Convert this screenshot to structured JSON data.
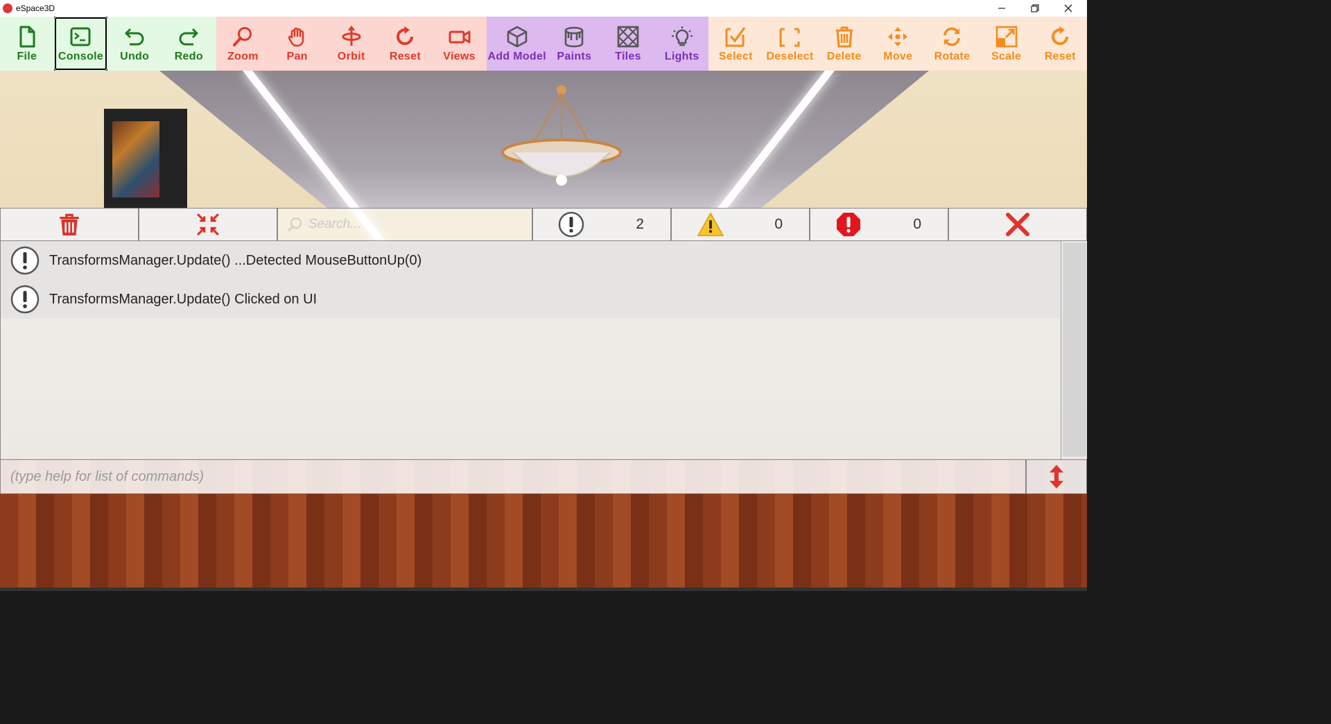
{
  "window": {
    "title": "eSpace3D"
  },
  "toolbar": {
    "file": "File",
    "console": "Console",
    "undo": "Undo",
    "redo": "Redo",
    "zoom": "Zoom",
    "pan": "Pan",
    "orbit": "Orbit",
    "reset_camera": "Reset",
    "views": "Views",
    "add_model": "Add Model",
    "paints": "Paints",
    "tiles": "Tiles",
    "lights": "Lights",
    "select": "Select",
    "deselect": "Deselect",
    "delete": "Delete",
    "move": "Move",
    "rotate": "Rotate",
    "scale": "Scale",
    "reset_transform": "Reset"
  },
  "colors": {
    "file_group_bg": "#e3f9e3",
    "file_group_fg": "#1e7a1e",
    "camera_group_bg": "#fcd6d0",
    "camera_group_fg": "#e0392b",
    "model_group_bg": "#dcb9ef",
    "model_group_fg": "#7b2fb4",
    "transform_group_bg": "#fde7d7",
    "transform_group_fg": "#f28d1d"
  },
  "console": {
    "search_placeholder": "Search...",
    "info_count": "2",
    "warning_count": "0",
    "error_count": "0",
    "logs": [
      {
        "type": "info-icon",
        "text": "TransformsManager.Update() ...Detected MouseButtonUp(0)"
      },
      {
        "type": "info-icon",
        "text": "TransformsManager.Update() Clicked on UI"
      }
    ],
    "command_placeholder": "(type help for list of commands)"
  }
}
